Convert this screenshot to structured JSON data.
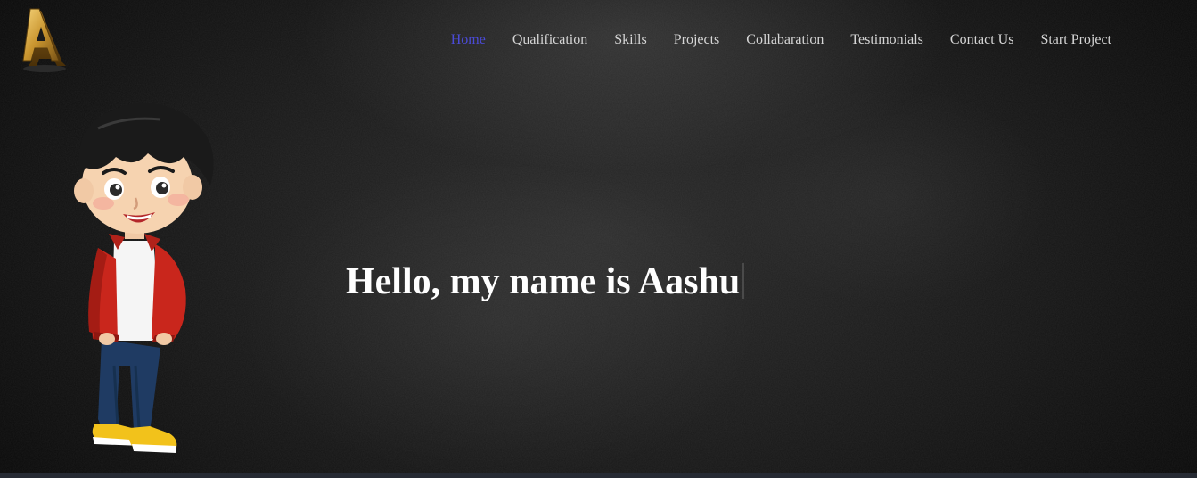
{
  "nav": {
    "items": [
      {
        "label": "Home",
        "active": true
      },
      {
        "label": "Qualification",
        "active": false
      },
      {
        "label": "Skills",
        "active": false
      },
      {
        "label": "Projects",
        "active": false
      },
      {
        "label": "Collabaration",
        "active": false
      },
      {
        "label": "Testimonials",
        "active": false
      },
      {
        "label": "Contact Us",
        "active": false
      },
      {
        "label": "Start Project",
        "active": false
      }
    ]
  },
  "logo": {
    "letter": "A",
    "icon": "gold-letter-a-logo"
  },
  "hero": {
    "title": "Hello, my name is Aashu",
    "illustration": "cartoon-boy-red-jacket"
  },
  "colors": {
    "background": "#161616",
    "nav_text": "#d6d6d6",
    "nav_active": "#4b4bd8",
    "hero_text": "#ffffff",
    "logo_gold": "#c9952f",
    "bottom_bar": "#262a33"
  }
}
